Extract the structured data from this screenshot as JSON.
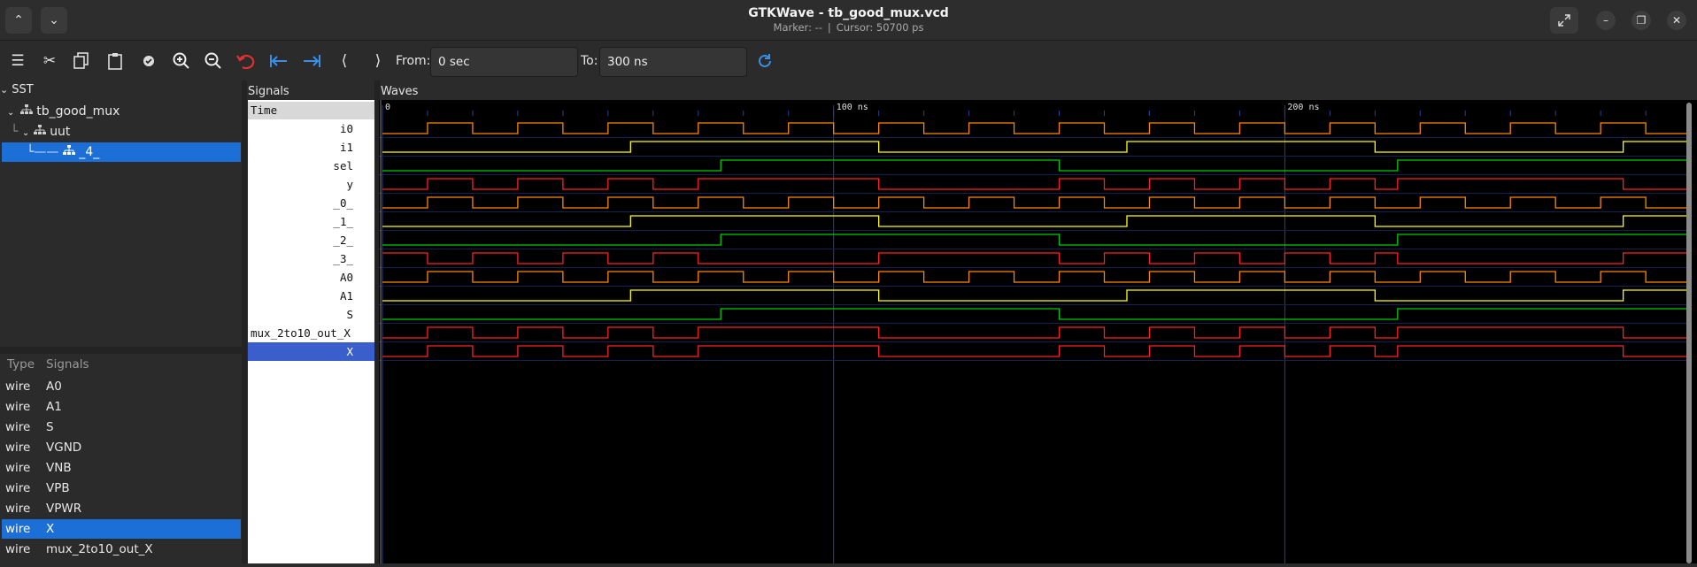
{
  "window": {
    "title": "GTKWave - tb_good_mux.vcd",
    "marker": "Marker: --",
    "cursor": "Cursor: 50700 ps"
  },
  "toolbar": {
    "from_label": "From:",
    "from_value": "0 sec",
    "to_label": "To:",
    "to_value": "300 ns"
  },
  "sst": {
    "label": "SST",
    "tree": [
      "tb_good_mux",
      "uut",
      "_4_"
    ],
    "selected": "_4_"
  },
  "signal_list": {
    "type_header": "Type",
    "signals_header": "Signals",
    "rows": [
      {
        "type": "wire",
        "name": "A0"
      },
      {
        "type": "wire",
        "name": "A1"
      },
      {
        "type": "wire",
        "name": "S"
      },
      {
        "type": "wire",
        "name": "VGND"
      },
      {
        "type": "wire",
        "name": "VNB"
      },
      {
        "type": "wire",
        "name": "VPB"
      },
      {
        "type": "wire",
        "name": "VPWR"
      },
      {
        "type": "wire",
        "name": "X"
      },
      {
        "type": "wire",
        "name": "mux_2to10_out_X"
      }
    ],
    "selected": "X"
  },
  "signals_pane": {
    "label": "Signals",
    "time_label": "Time",
    "names": [
      "i0",
      "i1",
      "sel",
      "y",
      "_0_",
      "_1_",
      "_2_",
      "_3_",
      "A0",
      "A1",
      "S",
      "mux_2to10_out_X",
      "X"
    ],
    "selected": "X"
  },
  "waves_pane": {
    "label": "Waves",
    "time_ticks": [
      {
        "t": 0,
        "label": "0"
      },
      {
        "t": 100,
        "label": "100 ns"
      },
      {
        "t": 200,
        "label": "200 ns"
      }
    ],
    "view_end_ns": 289,
    "colors": {
      "orange": "#ff8800",
      "yellow": "#ffff00",
      "green": "#00cc00",
      "red": "#ff2020",
      "grid": "#2a3f9a"
    },
    "traces": [
      {
        "name": "i0",
        "color": "#ff8800",
        "start": 0,
        "edges": [
          10,
          20,
          30,
          40,
          50,
          60,
          70,
          80,
          90,
          100,
          110,
          120,
          130,
          140,
          150,
          160,
          170,
          180,
          190,
          200,
          210,
          220,
          230,
          240,
          250,
          260,
          270,
          280
        ]
      },
      {
        "name": "i1",
        "color": "#ffff00",
        "start": 0,
        "edges": [
          55,
          110,
          165,
          220,
          275
        ]
      },
      {
        "name": "sel",
        "color": "#00cc00",
        "start": 0,
        "edges": [
          75,
          150,
          225
        ]
      },
      {
        "name": "y",
        "color": "#ff2020",
        "start": 0,
        "edges": [
          10,
          20,
          30,
          40,
          50,
          60,
          70,
          110,
          150,
          160,
          170,
          180,
          190,
          200,
          210,
          220,
          225,
          275
        ]
      },
      {
        "name": "_0_",
        "color": "#ff8800",
        "start": 0,
        "edges": [
          10,
          20,
          30,
          40,
          50,
          60,
          70,
          80,
          90,
          100,
          110,
          120,
          130,
          140,
          150,
          160,
          170,
          180,
          190,
          200,
          210,
          220,
          230,
          240,
          250,
          260,
          270,
          280
        ]
      },
      {
        "name": "_1_",
        "color": "#ffff00",
        "start": 0,
        "edges": [
          55,
          110,
          165,
          220,
          275
        ]
      },
      {
        "name": "_2_",
        "color": "#00cc00",
        "start": 0,
        "edges": [
          75,
          150,
          225
        ]
      },
      {
        "name": "_3_",
        "color": "#ff2020",
        "start": 1,
        "edges": [
          10,
          20,
          30,
          40,
          50,
          60,
          70,
          110,
          150,
          160,
          170,
          180,
          190,
          200,
          210,
          220,
          225,
          275
        ]
      },
      {
        "name": "A0",
        "color": "#ff8800",
        "start": 0,
        "edges": [
          10,
          20,
          30,
          40,
          50,
          60,
          70,
          80,
          90,
          100,
          110,
          120,
          130,
          140,
          150,
          160,
          170,
          180,
          190,
          200,
          210,
          220,
          230,
          240,
          250,
          260,
          270,
          280
        ]
      },
      {
        "name": "A1",
        "color": "#ffff00",
        "start": 0,
        "edges": [
          55,
          110,
          165,
          220,
          275
        ]
      },
      {
        "name": "S",
        "color": "#00cc00",
        "start": 0,
        "edges": [
          75,
          150,
          225
        ]
      },
      {
        "name": "mux_2to10_out_X",
        "color": "#ff2020",
        "start": 0,
        "edges": [
          10,
          20,
          30,
          40,
          50,
          60,
          70,
          110,
          150,
          160,
          170,
          180,
          190,
          200,
          210,
          220,
          225,
          275
        ]
      },
      {
        "name": "X",
        "color": "#ff2020",
        "start": 0,
        "edges": [
          10,
          20,
          30,
          40,
          50,
          60,
          70,
          110,
          150,
          160,
          170,
          180,
          190,
          200,
          210,
          220,
          225,
          275
        ]
      }
    ]
  }
}
